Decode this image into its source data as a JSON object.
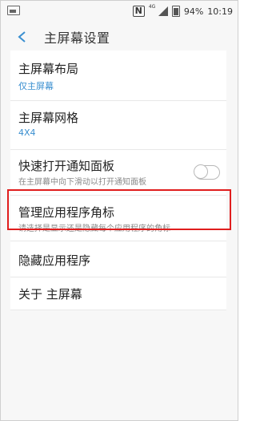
{
  "status_bar": {
    "nfc": "N",
    "network_type": "4G",
    "battery_percent": "94%",
    "time": "10:19"
  },
  "header": {
    "title": "主屏幕设置"
  },
  "settings": {
    "items": [
      {
        "label": "主屏幕布局",
        "value": "仅主屏幕"
      },
      {
        "label": "主屏幕网格",
        "value": "4X4"
      },
      {
        "label": "快速打开通知面板",
        "description": "在主屏幕中向下滑动以打开通知面板",
        "toggle_on": false
      },
      {
        "label": "管理应用程序角标",
        "description": "请选择是显示还是隐藏每个应用程序的角标"
      },
      {
        "label": "隐藏应用程序"
      },
      {
        "label": "关于 主屏幕"
      }
    ]
  },
  "colors": {
    "accent": "#3a8fd0",
    "highlight": "#e01e1e"
  }
}
